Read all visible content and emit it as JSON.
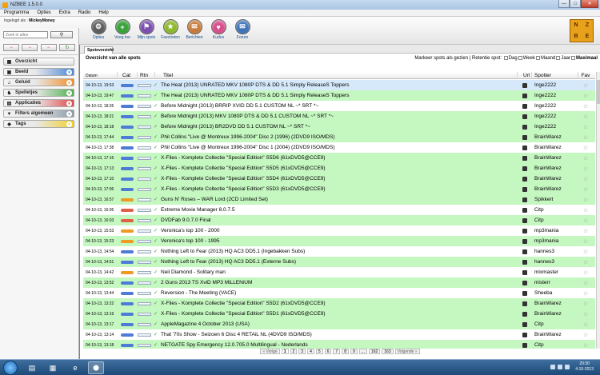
{
  "window": {
    "title": "NZBEE 1.5.0.0"
  },
  "menu": [
    "Programma",
    "Opties",
    "Extra",
    "Radio",
    "Help"
  ],
  "login": {
    "label": "Ingelogd als :",
    "user": "MickeyMoney"
  },
  "search": {
    "placeholder": "Zoek in alles"
  },
  "toolbar": [
    {
      "label": "Opties",
      "icon": "gear-icon",
      "color": "#5d5d5d"
    },
    {
      "label": "Voeg toe",
      "icon": "plus-icon",
      "color": "#3aa23a"
    },
    {
      "label": "Mijn spots",
      "icon": "bookmark-icon",
      "color": "#7b4fb0"
    },
    {
      "label": "Favorieten",
      "icon": "star-icon",
      "color": "#8cb82b"
    },
    {
      "label": "Berichten",
      "icon": "envelope-icon",
      "color": "#c87a3a"
    },
    {
      "label": "Kudos",
      "icon": "heart-icon",
      "color": "#d64f8c"
    },
    {
      "label": "Forum",
      "icon": "forum-icon",
      "color": "#3d73b8"
    }
  ],
  "logo": {
    "letters": [
      "N",
      "Z",
      "B",
      "E"
    ]
  },
  "sidebar": {
    "nav": [
      {
        "label": "Overzicht",
        "icon": "overview-icon",
        "color": "#ffffff",
        "active": true
      },
      {
        "label": "Beeld",
        "icon": "film-icon",
        "color": "#4a86d8"
      },
      {
        "label": "Geluid",
        "icon": "music-icon",
        "color": "#ef8f2a"
      },
      {
        "label": "Spelletjes",
        "icon": "game-icon",
        "color": "#4fb04f"
      },
      {
        "label": "Applicaties",
        "icon": "app-icon",
        "color": "#e14a4a"
      },
      {
        "label": "Filters algemeen",
        "icon": "filter-icon",
        "color": "#8b9aaa"
      },
      {
        "label": "Tags",
        "icon": "tag-icon",
        "color": "#f1d22e"
      }
    ]
  },
  "tabs": {
    "active": "Spotoverzicht"
  },
  "overview": {
    "title": "Overzicht van alle spots",
    "retention_prefix": "Markeer spots als gezien | Retentie spot:",
    "retention_options": [
      "Dag",
      "Week",
      "Maand",
      "Jaar",
      "Maximaal"
    ]
  },
  "columns": [
    "Datum",
    "Cat",
    "Rtn",
    "Titel",
    "Url",
    "Spotter",
    "Fav"
  ],
  "rows": [
    {
      "date": "04-10-13, 19:53",
      "cat": "blue",
      "title": "The Heat (2013) UNRATED MKV 1080P DTS & DD 5.1 Simply ReleaseS Toppers",
      "spotter": "Inge2222",
      "bg": "selected"
    },
    {
      "date": "04-10-13, 19:47",
      "cat": "blue",
      "title": "The Heat (2013) UNRATED MKV 1080P DTS & DD 5.1 Simply ReleaseS Toppers",
      "spotter": "Inge2222",
      "bg": "green"
    },
    {
      "date": "04-10-13, 18:26",
      "cat": "blue",
      "title": "Before Midnight (2013) BRRIP XVID DD 5.1 CUSTOM NL ~* SRT *~",
      "spotter": "Inge2222",
      "bg": "white"
    },
    {
      "date": "04-10-13, 18:21",
      "cat": "blue",
      "title": "Before Midnight (2013) MKV 1080P DTS & DD 5.1 CUSTOM NL ~* SRT *~",
      "spotter": "Inge2222",
      "bg": "green"
    },
    {
      "date": "04-10-13, 18:18",
      "cat": "blue",
      "title": "Before Midnight (2013) BR2DVD DD 5.1 CUSTOM NL ~* SRT *~",
      "spotter": "Inge2222",
      "bg": "green"
    },
    {
      "date": "04-10-13, 17:44",
      "cat": "blue",
      "title": "Phil Collins \"Live @ Montreux 1996-2004\" Disc 2 (1996) (2DVD9 ISO/MDS)",
      "spotter": "BrainWarez",
      "bg": "green"
    },
    {
      "date": "04-10-13, 17:38",
      "cat": "blue",
      "title": "Phil Collins \"Live @ Montreux 1996-2004\" Disc 1 (2004) (2DVD9 ISO/MDS)",
      "spotter": "BrainWarez",
      "bg": "white"
    },
    {
      "date": "04-10-13, 17:16",
      "cat": "blue",
      "title": "X-Files - Komplete Collectie \"Special Edition\" S5D6 (61xDVD5@CCE9)",
      "spotter": "BrainWarez",
      "bg": "green"
    },
    {
      "date": "04-10-13, 17:13",
      "cat": "blue",
      "title": "X-Files - Komplete Collectie \"Special Edition\" S5D5 (61xDVD5@CCE9)",
      "spotter": "BrainWarez",
      "bg": "green"
    },
    {
      "date": "04-10-13, 17:10",
      "cat": "blue",
      "title": "X-Files - Komplete Collectie \"Special Edition\" S5D4 (61xDVD5@CCE9)",
      "spotter": "BrainWarez",
      "bg": "green"
    },
    {
      "date": "04-10-13, 17:06",
      "cat": "blue",
      "title": "X-Files - Komplete Collectie \"Special Edition\" S5D3 (61xDVD5@CCE9)",
      "spotter": "BrainWarez",
      "bg": "green"
    },
    {
      "date": "04-10-13, 16:57",
      "cat": "orange",
      "title": "Guns N' Roses – WAR Lord (2CD Limited Set)",
      "spotter": "Spikkert",
      "bg": "green"
    },
    {
      "date": "04-10-13, 16:05",
      "cat": "red",
      "title": "Extreme Movie Manager 8.0.7.5",
      "spotter": "Citp",
      "bg": "white"
    },
    {
      "date": "04-10-13, 16:03",
      "cat": "red",
      "title": "DVDFab 9.0.7.0 Final",
      "spotter": "Citp",
      "bg": "green"
    },
    {
      "date": "04-10-13, 15:53",
      "cat": "orange",
      "title": "Veronica's top 100 - 2000",
      "spotter": "mp3mania",
      "bg": "white"
    },
    {
      "date": "04-10-13, 15:23",
      "cat": "orange",
      "title": "Veronica's top 100 - 1995",
      "spotter": "mp3mania",
      "bg": "green"
    },
    {
      "date": "04-10-13, 14:54",
      "cat": "blue",
      "title": "Nothing Left to Fear (2013) HQ AC3 DD5.1 (Ingebakken Subs)",
      "spotter": "hannes3",
      "bg": "white"
    },
    {
      "date": "04-10-13, 14:51",
      "cat": "blue",
      "title": "Nothing Left to Fear (2013) HQ AC3 DD5.1 (Externe Subs)",
      "spotter": "hannes3",
      "bg": "green"
    },
    {
      "date": "04-10-13, 14:42",
      "cat": "orange",
      "title": "Neil Diamond - Solitary man",
      "spotter": "mixmaster",
      "bg": "white"
    },
    {
      "date": "04-10-13, 13:52",
      "cat": "blue",
      "title": "2 Guns 2013 TS XviD MP3 MiLLENiUM",
      "spotter": "misterr",
      "bg": "green"
    },
    {
      "date": "04-10-13, 13:44",
      "cat": "blue",
      "title": "Reversion - The Meeting (VACE)",
      "spotter": "Sheeba",
      "bg": "white"
    },
    {
      "date": "04-10-13, 13:22",
      "cat": "blue",
      "title": "X-Files - Komplete Collectie \"Special Edition\" S5D2 (61xDVD5@CCE9)",
      "spotter": "BrainWarez",
      "bg": "green"
    },
    {
      "date": "04-10-13, 13:19",
      "cat": "blue",
      "title": "X-Files - Komplete Collectie \"Special Edition\" S5D1 (61xDVD5@CCE9)",
      "spotter": "BrainWarez",
      "bg": "green"
    },
    {
      "date": "04-10-13, 13:17",
      "cat": "blue",
      "title": "AppleMagazine 4 October 2013 (USA)",
      "spotter": "Citp",
      "bg": "green"
    },
    {
      "date": "04-10-13, 13:14",
      "cat": "blue",
      "title": "That '70s Show - Seizoen 6 Disc 4 RETAiL NL (4DVD9 ISO/MDS)",
      "spotter": "BrainWarez",
      "bg": "white"
    },
    {
      "date": "04-10-13, 13:18",
      "cat": "blue",
      "title": "NETGATE Spy Emergency 12.0.705.0 Multilingual - Nederlands",
      "spotter": "Citp",
      "bg": "green"
    }
  ],
  "pager": {
    "prev": "« Vorige",
    "pages": [
      "1",
      "2",
      "3",
      "4",
      "5",
      "6",
      "7",
      "8",
      "9",
      "...",
      "162",
      "163"
    ],
    "current": "1",
    "next": "Volgende »"
  },
  "taskbar": {
    "time": "20:30",
    "date": "4-10-2013"
  }
}
